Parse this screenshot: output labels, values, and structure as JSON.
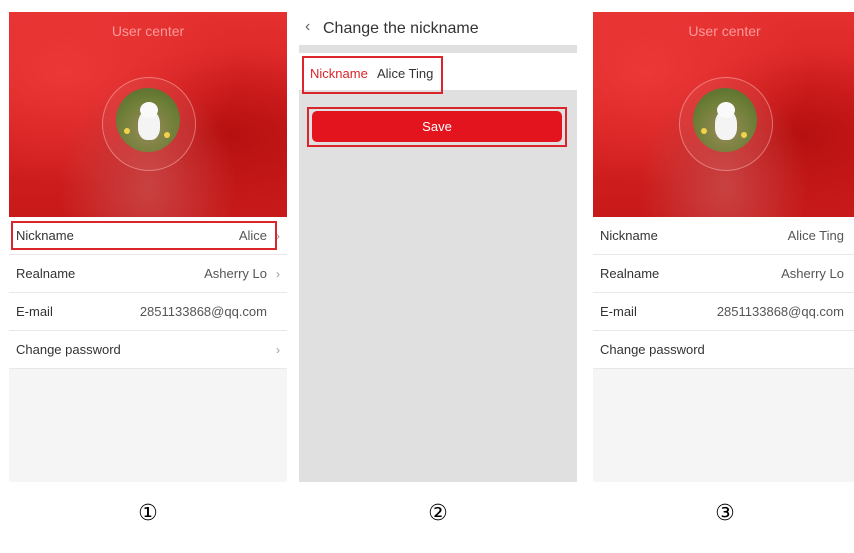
{
  "colors": {
    "accent": "#e3141e",
    "highlight": "#d9252b"
  },
  "screen1": {
    "header_title": "User center",
    "rows": [
      {
        "label": "Nickname",
        "value": "Alice",
        "chevron": "›"
      },
      {
        "label": "Realname",
        "value": "Asherry Lo",
        "chevron": "›"
      },
      {
        "label": "E-mail",
        "value": "2851133868@qq.com",
        "chevron": ""
      },
      {
        "label": "Change password",
        "value": "",
        "chevron": "›"
      }
    ],
    "step_label": "①"
  },
  "screen2": {
    "back_icon": "‹",
    "title": "Change the nickname",
    "nickname_label": "Nickname",
    "nickname_value": "Alice Ting",
    "save_label": "Save",
    "step_label": "②"
  },
  "screen3": {
    "header_title": "User center",
    "rows": [
      {
        "label": "Nickname",
        "value": "Alice Ting",
        "chevron": "›"
      },
      {
        "label": "Realname",
        "value": "Asherry Lo",
        "chevron": "›"
      },
      {
        "label": "E-mail",
        "value": "2851133868@qq.com",
        "chevron": ""
      },
      {
        "label": "Change password",
        "value": "",
        "chevron": "›"
      }
    ],
    "step_label": "③"
  }
}
